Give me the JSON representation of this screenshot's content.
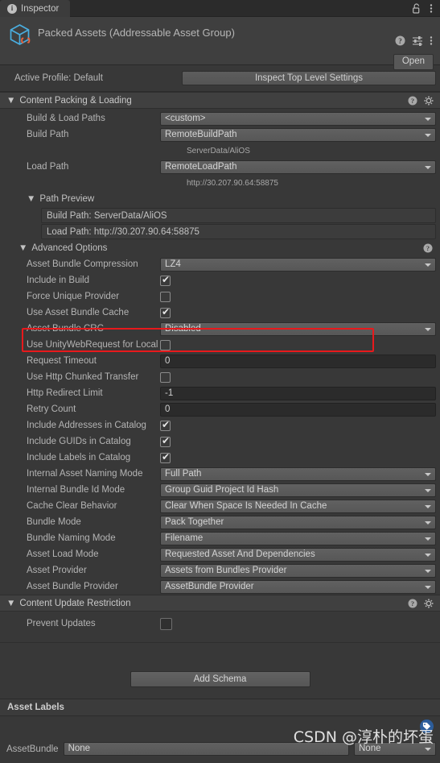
{
  "window": {
    "tab_label": "Inspector",
    "tab_icon": "info-icon",
    "lock_icon": "lock-open-icon",
    "menu_icon": "kebab-menu-icon"
  },
  "object_header": {
    "icon": "addressable-asset-group-icon",
    "title": "Packed Assets (Addressable Asset Group)",
    "help_icon": "help-icon",
    "preset_icon": "preset-settings-icon",
    "menu_icon": "kebab-menu-icon",
    "open_button": "Open"
  },
  "profile": {
    "label": "Active Profile: Default",
    "button": "Inspect Top Level Settings"
  },
  "content_packing": {
    "title": "Content Packing & Loading",
    "arrow": "▼",
    "help_icon": "help-icon",
    "gear_icon": "gear-icon",
    "rows": [
      {
        "label": "Build & Load Paths",
        "type": "dropdown",
        "value": "<custom>"
      },
      {
        "label": "Build Path",
        "type": "dropdown",
        "value": "RemoteBuildPath"
      },
      {
        "label": "",
        "type": "hint",
        "value": "ServerData/AliOS"
      },
      {
        "label": "Load Path",
        "type": "dropdown",
        "value": "RemoteLoadPath"
      },
      {
        "label": "",
        "type": "hint",
        "value": "http://30.207.90.64:58875"
      }
    ],
    "path_preview": {
      "title": "Path Preview",
      "arrow": "▼",
      "lines": [
        "Build Path: ServerData/AliOS",
        "Load Path: http://30.207.90.64:58875"
      ]
    },
    "advanced_options": {
      "title": "Advanced Options",
      "arrow": "▼",
      "help_icon": "help-icon",
      "rows": [
        {
          "label": "Asset Bundle Compression",
          "type": "dropdown",
          "value": "LZ4"
        },
        {
          "label": "Include in Build",
          "type": "checkbox",
          "checked": true
        },
        {
          "label": "Force Unique Provider",
          "type": "checkbox",
          "checked": false
        },
        {
          "label": "Use Asset Bundle Cache",
          "type": "checkbox",
          "checked": true
        },
        {
          "label": "Asset Bundle CRC",
          "type": "dropdown",
          "value": "Disabled",
          "highlighted": true
        },
        {
          "label": "Use UnityWebRequest for Local A",
          "type": "checkbox",
          "checked": false
        },
        {
          "label": "Request Timeout",
          "type": "number",
          "value": "0"
        },
        {
          "label": "Use Http Chunked Transfer",
          "type": "checkbox",
          "checked": false
        },
        {
          "label": "Http Redirect Limit",
          "type": "number",
          "value": "-1"
        },
        {
          "label": "Retry Count",
          "type": "number",
          "value": "0"
        },
        {
          "label": "Include Addresses in Catalog",
          "type": "checkbox",
          "checked": true
        },
        {
          "label": "Include GUIDs in Catalog",
          "type": "checkbox",
          "checked": true
        },
        {
          "label": "Include Labels in Catalog",
          "type": "checkbox",
          "checked": true
        },
        {
          "label": "Internal Asset Naming Mode",
          "type": "dropdown",
          "value": "Full Path"
        },
        {
          "label": "Internal Bundle Id Mode",
          "type": "dropdown",
          "value": "Group Guid Project Id Hash"
        },
        {
          "label": "Cache Clear Behavior",
          "type": "dropdown",
          "value": "Clear When Space Is Needed In Cache"
        },
        {
          "label": "Bundle Mode",
          "type": "dropdown",
          "value": "Pack Together"
        },
        {
          "label": "Bundle Naming Mode",
          "type": "dropdown",
          "value": "Filename"
        },
        {
          "label": "Asset Load Mode",
          "type": "dropdown",
          "value": "Requested Asset And Dependencies"
        },
        {
          "label": "Asset Provider",
          "type": "dropdown",
          "value": "Assets from Bundles Provider"
        },
        {
          "label": "Asset Bundle Provider",
          "type": "dropdown",
          "value": "AssetBundle Provider"
        }
      ]
    }
  },
  "content_update": {
    "title": "Content Update Restriction",
    "arrow": "▼",
    "help_icon": "help-icon",
    "gear_icon": "gear-icon",
    "rows": [
      {
        "label": "Prevent Updates",
        "type": "checkbox",
        "checked": false
      }
    ]
  },
  "add_schema_button": "Add Schema",
  "asset_labels": {
    "title": "Asset Labels",
    "tag_icon": "tag-icon",
    "assetbundle_label": "AssetBundle",
    "assetbundle_value": "None",
    "variant_value": "None"
  },
  "watermark": "CSDN @淳朴的坏蛋",
  "colors": {
    "panel_bg": "#383838",
    "header_bg": "#404040",
    "dropdown_bg": "#5b5b5b",
    "field_bg": "#2b2b2b",
    "highlight": "#e8191c",
    "icon_blue": "#4aaee0",
    "icon_orange": "#e8623c",
    "tag_blue": "#2c5d9b"
  }
}
